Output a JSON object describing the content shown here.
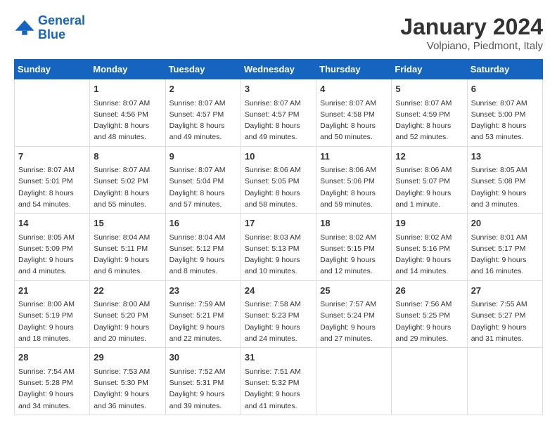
{
  "logo": {
    "line1": "General",
    "line2": "Blue"
  },
  "title": "January 2024",
  "location": "Volpiano, Piedmont, Italy",
  "days_of_week": [
    "Sunday",
    "Monday",
    "Tuesday",
    "Wednesday",
    "Thursday",
    "Friday",
    "Saturday"
  ],
  "weeks": [
    [
      {
        "day": "",
        "info": ""
      },
      {
        "day": "1",
        "info": "Sunrise: 8:07 AM\nSunset: 4:56 PM\nDaylight: 8 hours\nand 48 minutes."
      },
      {
        "day": "2",
        "info": "Sunrise: 8:07 AM\nSunset: 4:57 PM\nDaylight: 8 hours\nand 49 minutes."
      },
      {
        "day": "3",
        "info": "Sunrise: 8:07 AM\nSunset: 4:57 PM\nDaylight: 8 hours\nand 49 minutes."
      },
      {
        "day": "4",
        "info": "Sunrise: 8:07 AM\nSunset: 4:58 PM\nDaylight: 8 hours\nand 50 minutes."
      },
      {
        "day": "5",
        "info": "Sunrise: 8:07 AM\nSunset: 4:59 PM\nDaylight: 8 hours\nand 52 minutes."
      },
      {
        "day": "6",
        "info": "Sunrise: 8:07 AM\nSunset: 5:00 PM\nDaylight: 8 hours\nand 53 minutes."
      }
    ],
    [
      {
        "day": "7",
        "info": "Sunrise: 8:07 AM\nSunset: 5:01 PM\nDaylight: 8 hours\nand 54 minutes."
      },
      {
        "day": "8",
        "info": "Sunrise: 8:07 AM\nSunset: 5:02 PM\nDaylight: 8 hours\nand 55 minutes."
      },
      {
        "day": "9",
        "info": "Sunrise: 8:07 AM\nSunset: 5:04 PM\nDaylight: 8 hours\nand 57 minutes."
      },
      {
        "day": "10",
        "info": "Sunrise: 8:06 AM\nSunset: 5:05 PM\nDaylight: 8 hours\nand 58 minutes."
      },
      {
        "day": "11",
        "info": "Sunrise: 8:06 AM\nSunset: 5:06 PM\nDaylight: 8 hours\nand 59 minutes."
      },
      {
        "day": "12",
        "info": "Sunrise: 8:06 AM\nSunset: 5:07 PM\nDaylight: 9 hours\nand 1 minute."
      },
      {
        "day": "13",
        "info": "Sunrise: 8:05 AM\nSunset: 5:08 PM\nDaylight: 9 hours\nand 3 minutes."
      }
    ],
    [
      {
        "day": "14",
        "info": "Sunrise: 8:05 AM\nSunset: 5:09 PM\nDaylight: 9 hours\nand 4 minutes."
      },
      {
        "day": "15",
        "info": "Sunrise: 8:04 AM\nSunset: 5:11 PM\nDaylight: 9 hours\nand 6 minutes."
      },
      {
        "day": "16",
        "info": "Sunrise: 8:04 AM\nSunset: 5:12 PM\nDaylight: 9 hours\nand 8 minutes."
      },
      {
        "day": "17",
        "info": "Sunrise: 8:03 AM\nSunset: 5:13 PM\nDaylight: 9 hours\nand 10 minutes."
      },
      {
        "day": "18",
        "info": "Sunrise: 8:02 AM\nSunset: 5:15 PM\nDaylight: 9 hours\nand 12 minutes."
      },
      {
        "day": "19",
        "info": "Sunrise: 8:02 AM\nSunset: 5:16 PM\nDaylight: 9 hours\nand 14 minutes."
      },
      {
        "day": "20",
        "info": "Sunrise: 8:01 AM\nSunset: 5:17 PM\nDaylight: 9 hours\nand 16 minutes."
      }
    ],
    [
      {
        "day": "21",
        "info": "Sunrise: 8:00 AM\nSunset: 5:19 PM\nDaylight: 9 hours\nand 18 minutes."
      },
      {
        "day": "22",
        "info": "Sunrise: 8:00 AM\nSunset: 5:20 PM\nDaylight: 9 hours\nand 20 minutes."
      },
      {
        "day": "23",
        "info": "Sunrise: 7:59 AM\nSunset: 5:21 PM\nDaylight: 9 hours\nand 22 minutes."
      },
      {
        "day": "24",
        "info": "Sunrise: 7:58 AM\nSunset: 5:23 PM\nDaylight: 9 hours\nand 24 minutes."
      },
      {
        "day": "25",
        "info": "Sunrise: 7:57 AM\nSunset: 5:24 PM\nDaylight: 9 hours\nand 27 minutes."
      },
      {
        "day": "26",
        "info": "Sunrise: 7:56 AM\nSunset: 5:25 PM\nDaylight: 9 hours\nand 29 minutes."
      },
      {
        "day": "27",
        "info": "Sunrise: 7:55 AM\nSunset: 5:27 PM\nDaylight: 9 hours\nand 31 minutes."
      }
    ],
    [
      {
        "day": "28",
        "info": "Sunrise: 7:54 AM\nSunset: 5:28 PM\nDaylight: 9 hours\nand 34 minutes."
      },
      {
        "day": "29",
        "info": "Sunrise: 7:53 AM\nSunset: 5:30 PM\nDaylight: 9 hours\nand 36 minutes."
      },
      {
        "day": "30",
        "info": "Sunrise: 7:52 AM\nSunset: 5:31 PM\nDaylight: 9 hours\nand 39 minutes."
      },
      {
        "day": "31",
        "info": "Sunrise: 7:51 AM\nSunset: 5:32 PM\nDaylight: 9 hours\nand 41 minutes."
      },
      {
        "day": "",
        "info": ""
      },
      {
        "day": "",
        "info": ""
      },
      {
        "day": "",
        "info": ""
      }
    ]
  ]
}
